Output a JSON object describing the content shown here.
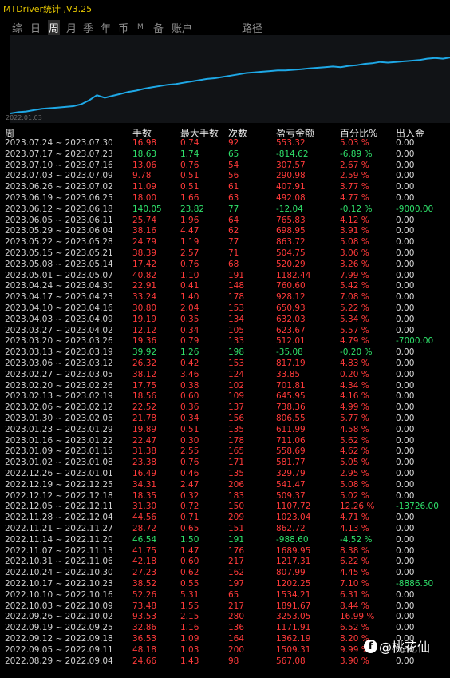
{
  "app": {
    "title": "MTDriver统计 ,V3.25"
  },
  "tabs": [
    {
      "label": "综",
      "active": false
    },
    {
      "label": "日",
      "active": false
    },
    {
      "label": "周",
      "active": true
    },
    {
      "label": "月",
      "active": false
    },
    {
      "label": "季",
      "active": false
    },
    {
      "label": "年",
      "active": false
    },
    {
      "label": "币",
      "active": false
    },
    {
      "label": "M",
      "active": false
    },
    {
      "label": "备",
      "active": false
    },
    {
      "label": "账户",
      "active": false
    },
    {
      "label": "路径",
      "active": false
    }
  ],
  "chart": {
    "start_date_label": "2022.01.03",
    "line_color": "#1ea8e6",
    "equity": [
      0,
      2,
      3,
      5,
      7,
      8,
      9,
      10,
      11,
      14,
      20,
      28,
      24,
      27,
      30,
      33,
      35,
      38,
      40,
      42,
      44,
      45,
      47,
      49,
      51,
      53,
      54,
      56,
      58,
      60,
      62,
      63,
      64,
      65,
      66,
      66,
      67,
      68,
      69,
      70,
      71,
      72,
      71,
      73,
      74,
      76,
      77,
      79,
      78,
      79,
      80,
      81,
      82,
      84,
      85,
      84,
      86
    ]
  },
  "table": {
    "headers": {
      "week": "周",
      "lots": "手数",
      "max_lots": "最大手数",
      "count": "次数",
      "pnl": "盈亏金额",
      "pct": "百分比%",
      "flow": "出入金"
    },
    "rows": [
      {
        "week": "2023.07.24 ~ 2023.07.30",
        "lots": "16.98",
        "max_lots": "0.74",
        "count": "92",
        "pnl": "553.32",
        "pct": "5.03 %",
        "flow": "0.00"
      },
      {
        "week": "2023.07.17 ~ 2023.07.23",
        "lots": "18.63",
        "max_lots": "1.74",
        "count": "65",
        "pnl": "-814.62",
        "pct": "-6.89 %",
        "flow": "0.00"
      },
      {
        "week": "2023.07.10 ~ 2023.07.16",
        "lots": "13.06",
        "max_lots": "0.76",
        "count": "54",
        "pnl": "307.57",
        "pct": "2.67 %",
        "flow": "0.00"
      },
      {
        "week": "2023.07.03 ~ 2023.07.09",
        "lots": "9.78",
        "max_lots": "0.51",
        "count": "56",
        "pnl": "290.98",
        "pct": "2.59 %",
        "flow": "0.00"
      },
      {
        "week": "2023.06.26 ~ 2023.07.02",
        "lots": "11.09",
        "max_lots": "0.51",
        "count": "61",
        "pnl": "407.91",
        "pct": "3.77 %",
        "flow": "0.00"
      },
      {
        "week": "2023.06.19 ~ 2023.06.25",
        "lots": "18.00",
        "max_lots": "1.66",
        "count": "63",
        "pnl": "492.08",
        "pct": "4.77 %",
        "flow": "0.00"
      },
      {
        "week": "2023.06.12 ~ 2023.06.18",
        "lots": "140.05",
        "max_lots": "23.82",
        "count": "77",
        "pnl": "-12.04",
        "pct": "-0.12 %",
        "flow": "-9000.00"
      },
      {
        "week": "2023.06.05 ~ 2023.06.11",
        "lots": "25.74",
        "max_lots": "1.96",
        "count": "64",
        "pnl": "765.83",
        "pct": "4.12 %",
        "flow": "0.00"
      },
      {
        "week": "2023.05.29 ~ 2023.06.04",
        "lots": "38.16",
        "max_lots": "4.47",
        "count": "62",
        "pnl": "698.95",
        "pct": "3.91 %",
        "flow": "0.00"
      },
      {
        "week": "2023.05.22 ~ 2023.05.28",
        "lots": "24.79",
        "max_lots": "1.19",
        "count": "77",
        "pnl": "863.72",
        "pct": "5.08 %",
        "flow": "0.00"
      },
      {
        "week": "2023.05.15 ~ 2023.05.21",
        "lots": "38.39",
        "max_lots": "2.57",
        "count": "71",
        "pnl": "504.75",
        "pct": "3.06 %",
        "flow": "0.00"
      },
      {
        "week": "2023.05.08 ~ 2023.05.14",
        "lots": "17.42",
        "max_lots": "0.76",
        "count": "68",
        "pnl": "520.29",
        "pct": "3.26 %",
        "flow": "0.00"
      },
      {
        "week": "2023.05.01 ~ 2023.05.07",
        "lots": "40.82",
        "max_lots": "1.10",
        "count": "191",
        "pnl": "1182.44",
        "pct": "7.99 %",
        "flow": "0.00"
      },
      {
        "week": "2023.04.24 ~ 2023.04.30",
        "lots": "22.91",
        "max_lots": "0.41",
        "count": "148",
        "pnl": "760.60",
        "pct": "5.42 %",
        "flow": "0.00"
      },
      {
        "week": "2023.04.17 ~ 2023.04.23",
        "lots": "33.24",
        "max_lots": "1.40",
        "count": "178",
        "pnl": "928.12",
        "pct": "7.08 %",
        "flow": "0.00"
      },
      {
        "week": "2023.04.10 ~ 2023.04.16",
        "lots": "30.80",
        "max_lots": "2.04",
        "count": "153",
        "pnl": "650.93",
        "pct": "5.22 %",
        "flow": "0.00"
      },
      {
        "week": "2023.04.03 ~ 2023.04.09",
        "lots": "19.19",
        "max_lots": "0.35",
        "count": "134",
        "pnl": "632.03",
        "pct": "5.34 %",
        "flow": "0.00"
      },
      {
        "week": "2023.03.27 ~ 2023.04.02",
        "lots": "12.12",
        "max_lots": "0.34",
        "count": "105",
        "pnl": "623.67",
        "pct": "5.57 %",
        "flow": "0.00"
      },
      {
        "week": "2023.03.20 ~ 2023.03.26",
        "lots": "19.36",
        "max_lots": "0.79",
        "count": "133",
        "pnl": "512.01",
        "pct": "4.79 %",
        "flow": "-7000.00"
      },
      {
        "week": "2023.03.13 ~ 2023.03.19",
        "lots": "39.92",
        "max_lots": "1.26",
        "count": "198",
        "pnl": "-35.08",
        "pct": "-0.20 %",
        "flow": "0.00"
      },
      {
        "week": "2023.03.06 ~ 2023.03.12",
        "lots": "26.32",
        "max_lots": "0.42",
        "count": "153",
        "pnl": "817.19",
        "pct": "4.83 %",
        "flow": "0.00"
      },
      {
        "week": "2023.02.27 ~ 2023.03.05",
        "lots": "38.12",
        "max_lots": "3.46",
        "count": "124",
        "pnl": "33.85",
        "pct": "0.20 %",
        "flow": "0.00"
      },
      {
        "week": "2023.02.20 ~ 2023.02.26",
        "lots": "17.75",
        "max_lots": "0.38",
        "count": "102",
        "pnl": "701.81",
        "pct": "4.34 %",
        "flow": "0.00"
      },
      {
        "week": "2023.02.13 ~ 2023.02.19",
        "lots": "18.56",
        "max_lots": "0.60",
        "count": "109",
        "pnl": "645.95",
        "pct": "4.16 %",
        "flow": "0.00"
      },
      {
        "week": "2023.02.06 ~ 2023.02.12",
        "lots": "22.52",
        "max_lots": "0.36",
        "count": "137",
        "pnl": "738.36",
        "pct": "4.99 %",
        "flow": "0.00"
      },
      {
        "week": "2023.01.30 ~ 2023.02.05",
        "lots": "21.78",
        "max_lots": "0.34",
        "count": "156",
        "pnl": "806.55",
        "pct": "5.77 %",
        "flow": "0.00"
      },
      {
        "week": "2023.01.23 ~ 2023.01.29",
        "lots": "19.89",
        "max_lots": "0.51",
        "count": "135",
        "pnl": "611.99",
        "pct": "4.58 %",
        "flow": "0.00"
      },
      {
        "week": "2023.01.16 ~ 2023.01.22",
        "lots": "22.47",
        "max_lots": "0.30",
        "count": "178",
        "pnl": "711.06",
        "pct": "5.62 %",
        "flow": "0.00"
      },
      {
        "week": "2023.01.09 ~ 2023.01.15",
        "lots": "31.38",
        "max_lots": "2.55",
        "count": "165",
        "pnl": "558.69",
        "pct": "4.62 %",
        "flow": "0.00"
      },
      {
        "week": "2023.01.02 ~ 2023.01.08",
        "lots": "23.38",
        "max_lots": "0.76",
        "count": "171",
        "pnl": "581.77",
        "pct": "5.05 %",
        "flow": "0.00"
      },
      {
        "week": "2022.12.26 ~ 2023.01.01",
        "lots": "16.49",
        "max_lots": "0.46",
        "count": "135",
        "pnl": "329.79",
        "pct": "2.95 %",
        "flow": "0.00"
      },
      {
        "week": "2022.12.19 ~ 2022.12.25",
        "lots": "34.31",
        "max_lots": "2.47",
        "count": "206",
        "pnl": "541.47",
        "pct": "5.08 %",
        "flow": "0.00"
      },
      {
        "week": "2022.12.12 ~ 2022.12.18",
        "lots": "18.35",
        "max_lots": "0.32",
        "count": "183",
        "pnl": "509.37",
        "pct": "5.02 %",
        "flow": "0.00"
      },
      {
        "week": "2022.12.05 ~ 2022.12.11",
        "lots": "31.30",
        "max_lots": "0.72",
        "count": "150",
        "pnl": "1107.72",
        "pct": "12.26 %",
        "flow": "-13726.00"
      },
      {
        "week": "2022.11.28 ~ 2022.12.04",
        "lots": "44.56",
        "max_lots": "0.71",
        "count": "209",
        "pnl": "1023.04",
        "pct": "4.71 %",
        "flow": "0.00"
      },
      {
        "week": "2022.11.21 ~ 2022.11.27",
        "lots": "28.72",
        "max_lots": "0.65",
        "count": "151",
        "pnl": "862.72",
        "pct": "4.13 %",
        "flow": "0.00"
      },
      {
        "week": "2022.11.14 ~ 2022.11.20",
        "lots": "46.54",
        "max_lots": "1.50",
        "count": "191",
        "pnl": "-988.60",
        "pct": "-4.52 %",
        "flow": "0.00"
      },
      {
        "week": "2022.11.07 ~ 2022.11.13",
        "lots": "41.75",
        "max_lots": "1.47",
        "count": "176",
        "pnl": "1689.95",
        "pct": "8.38 %",
        "flow": "0.00"
      },
      {
        "week": "2022.10.31 ~ 2022.11.06",
        "lots": "42.18",
        "max_lots": "0.60",
        "count": "217",
        "pnl": "1217.31",
        "pct": "6.22 %",
        "flow": "0.00"
      },
      {
        "week": "2022.10.24 ~ 2022.10.30",
        "lots": "27.23",
        "max_lots": "0.62",
        "count": "162",
        "pnl": "807.99",
        "pct": "4.45 %",
        "flow": "0.00"
      },
      {
        "week": "2022.10.17 ~ 2022.10.23",
        "lots": "38.52",
        "max_lots": "0.55",
        "count": "197",
        "pnl": "1202.25",
        "pct": "7.10 %",
        "flow": "-8886.50"
      },
      {
        "week": "2022.10.10 ~ 2022.10.16",
        "lots": "52.26",
        "max_lots": "5.31",
        "count": "65",
        "pnl": "1534.21",
        "pct": "6.31 %",
        "flow": "0.00"
      },
      {
        "week": "2022.10.03 ~ 2022.10.09",
        "lots": "73.48",
        "max_lots": "1.55",
        "count": "217",
        "pnl": "1891.67",
        "pct": "8.44 %",
        "flow": "0.00"
      },
      {
        "week": "2022.09.26 ~ 2022.10.02",
        "lots": "93.53",
        "max_lots": "2.15",
        "count": "280",
        "pnl": "3253.05",
        "pct": "16.99 %",
        "flow": "0.00"
      },
      {
        "week": "2022.09.19 ~ 2022.09.25",
        "lots": "32.86",
        "max_lots": "1.16",
        "count": "136",
        "pnl": "1171.91",
        "pct": "6.52 %",
        "flow": "0.00"
      },
      {
        "week": "2022.09.12 ~ 2022.09.18",
        "lots": "36.53",
        "max_lots": "1.09",
        "count": "164",
        "pnl": "1362.19",
        "pct": "8.20 %",
        "flow": "0.00"
      },
      {
        "week": "2022.09.05 ~ 2022.09.11",
        "lots": "48.18",
        "max_lots": "1.03",
        "count": "200",
        "pnl": "1509.31",
        "pct": "9.99 %",
        "flow": "0.00"
      },
      {
        "week": "2022.08.29 ~ 2022.09.04",
        "lots": "24.66",
        "max_lots": "1.43",
        "count": "98",
        "pnl": "567.08",
        "pct": "3.90 %",
        "flow": "0.00"
      }
    ]
  },
  "watermark": {
    "text": "@桃花仙",
    "logo": "f"
  },
  "colors": {
    "profit": "#ff3a3a",
    "loss": "#2fe06a",
    "neutral": "#d8d8d8",
    "title": "#e8c800",
    "line": "#1ea8e6"
  }
}
